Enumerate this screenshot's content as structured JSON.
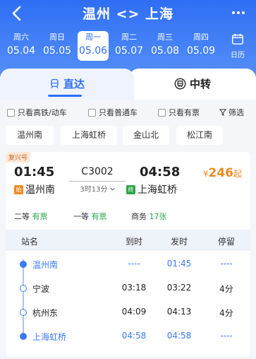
{
  "header": {
    "route_title": "温州 <> 上海",
    "dates": [
      {
        "weekday": "周六",
        "date": "05.04"
      },
      {
        "weekday": "周日",
        "date": "05.05"
      },
      {
        "weekday": "周一",
        "date": "05.06"
      },
      {
        "weekday": "周二",
        "date": "05.07"
      },
      {
        "weekday": "周三",
        "date": "05.08"
      },
      {
        "weekday": "周四",
        "date": "05.09"
      }
    ],
    "calendar_label": "日历"
  },
  "tabs": {
    "direct": "直达",
    "transfer": "中转"
  },
  "filters": {
    "high_speed": "只看高铁/动车",
    "regular": "只看普通车",
    "available": "只看有票",
    "filter": "筛选"
  },
  "station_chips": [
    "温州南",
    "上海虹桥",
    "金山北",
    "松江南"
  ],
  "train": {
    "badge": "复兴号",
    "dep_time": "01:45",
    "arr_time": "04:58",
    "number": "C3002",
    "duration": "3时13分",
    "price_symbol": "¥",
    "price": "246",
    "price_suffix": "起",
    "dep_station": "温州南",
    "arr_station": "上海虹桥",
    "dep_tag": "始",
    "arr_tag": "终",
    "seats": [
      {
        "class": "二等",
        "status": "有票"
      },
      {
        "class": "一等",
        "status": "有票"
      },
      {
        "class": "商务",
        "status": "17张"
      }
    ]
  },
  "stops_header": {
    "name": "站名",
    "arr": "到时",
    "dep": "发时",
    "stop": "停留"
  },
  "stops": [
    {
      "name": "温州南",
      "arr": "----",
      "dep": "01:45",
      "stop": "----"
    },
    {
      "name": "宁波",
      "arr": "03:18",
      "dep": "03:22",
      "stop": "4分"
    },
    {
      "name": "杭州东",
      "arr": "04:09",
      "dep": "04:13",
      "stop": "4分"
    },
    {
      "name": "上海虹桥",
      "arr": "04:58",
      "dep": "04:58",
      "stop": "----"
    }
  ],
  "colors": {
    "primary": "#2f6ef5",
    "price": "#f08a24",
    "available": "#2aa54a",
    "start_tag": "#f08a24",
    "end_tag": "#2aa54a"
  }
}
